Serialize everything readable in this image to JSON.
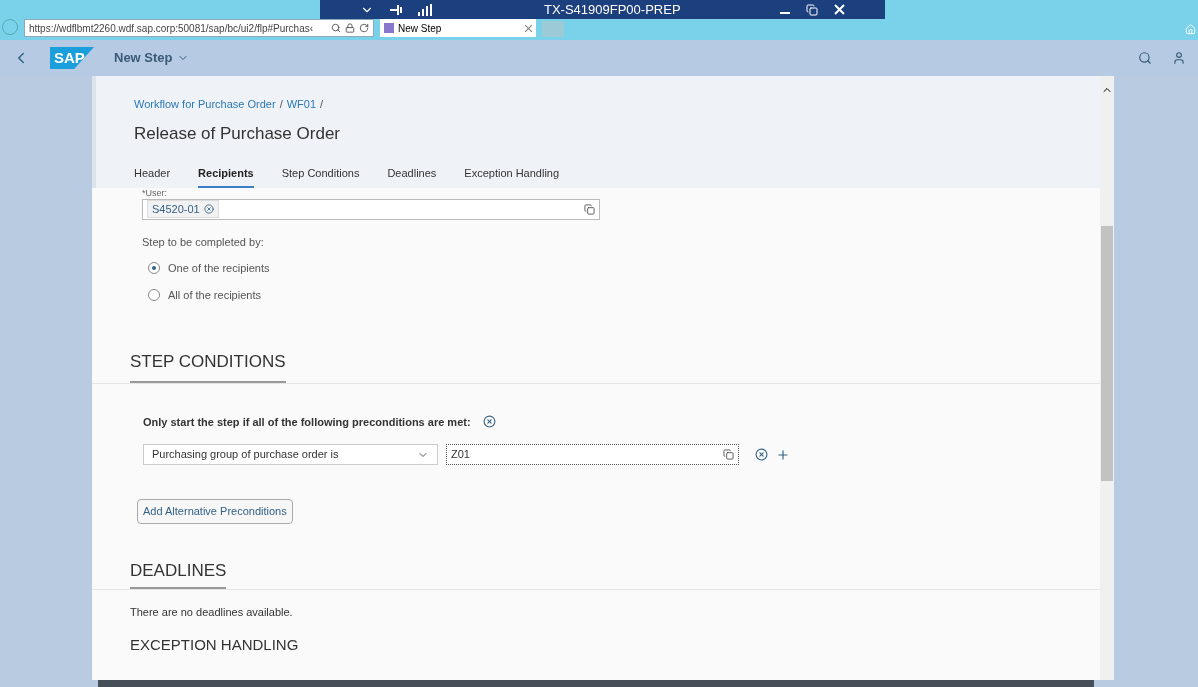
{
  "remote_bar": {
    "title": "TX-S41909FP00-PREP"
  },
  "browser": {
    "url": "https://wdflbmt2260.wdf.sap.corp:50081/sap/bc/ui2/flp#Purchas‹",
    "tab": "New Step"
  },
  "shell": {
    "logo": "SAP",
    "title": "New Step"
  },
  "header": {
    "breadcrumbs": [
      "Workflow for Purchase Order",
      "WF01"
    ],
    "separator": "/",
    "title": "Release of Purchase Order"
  },
  "tabs": [
    {
      "label": "Header",
      "selected": false
    },
    {
      "label": "Recipients",
      "selected": true
    },
    {
      "label": "Step Conditions",
      "selected": false
    },
    {
      "label": "Deadlines",
      "selected": false
    },
    {
      "label": "Exception Handling",
      "selected": false
    }
  ],
  "recipients": {
    "user_label": "*User:",
    "user_token": "S4520-01",
    "completion_label": "Step to be completed by:",
    "options": [
      {
        "label": "One of the recipients",
        "selected": true
      },
      {
        "label": "All of the recipients",
        "selected": false
      }
    ]
  },
  "step_conditions": {
    "heading": "STEP CONDITIONS",
    "intro": "Only start the step if all of the following preconditions are met:",
    "condition": "Purchasing group of purchase order is",
    "value": "Z01",
    "add_button": "Add Alternative Preconditions"
  },
  "deadlines": {
    "heading": "DEADLINES",
    "message": "There are no deadlines available."
  },
  "exception_handling": {
    "heading": "EXCEPTION HANDLING"
  }
}
